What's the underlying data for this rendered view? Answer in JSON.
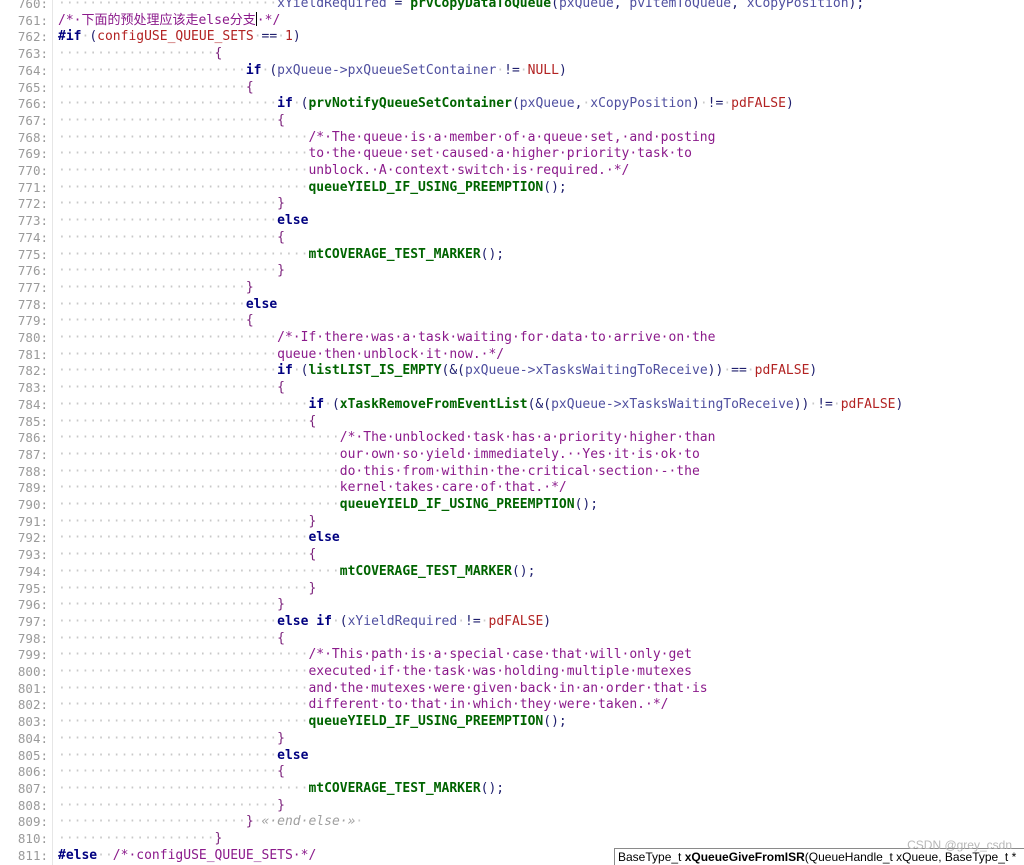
{
  "editor": {
    "lines": [
      {
        "num": "760:",
        "segs": [
          [
            "ws",
            "····························"
          ],
          [
            "var",
            "xYieldRequired"
          ],
          [
            "txt",
            " = "
          ],
          [
            "fn",
            "prvCopyDataToQueue"
          ],
          [
            "txt",
            "("
          ],
          [
            "var",
            "pxQueue"
          ],
          [
            "txt",
            ", "
          ],
          [
            "var",
            "pvItemToQueue"
          ],
          [
            "txt",
            ", "
          ],
          [
            "var",
            "xCopyPosition"
          ],
          [
            "txt",
            ");"
          ]
        ]
      },
      {
        "num": "761:",
        "segs": [
          [
            "cm",
            "/*·下面的预处理应该走else分支"
          ],
          [
            "caret",
            ""
          ],
          [
            "cm",
            "·*/"
          ]
        ]
      },
      {
        "num": "762:",
        "segs": [
          [
            "kw",
            "#if"
          ],
          [
            "ws",
            "·"
          ],
          [
            "txt",
            "("
          ],
          [
            "num",
            "configUSE_QUEUE_SETS"
          ],
          [
            "ws",
            "·"
          ],
          [
            "txt",
            "=="
          ],
          [
            "ws",
            "·"
          ],
          [
            "num",
            "1"
          ],
          [
            "txt",
            ")"
          ]
        ]
      },
      {
        "num": "763:",
        "segs": [
          [
            "ws",
            "····················"
          ],
          [
            "br",
            "{"
          ]
        ]
      },
      {
        "num": "764:",
        "segs": [
          [
            "ws",
            "························"
          ],
          [
            "kw",
            "if"
          ],
          [
            "ws",
            "·"
          ],
          [
            "txt",
            "("
          ],
          [
            "var",
            "pxQueue->pxQueueSetContainer"
          ],
          [
            "ws",
            "·"
          ],
          [
            "txt",
            "!="
          ],
          [
            "ws",
            "·"
          ],
          [
            "num",
            "NULL"
          ],
          [
            "txt",
            ")"
          ]
        ]
      },
      {
        "num": "765:",
        "segs": [
          [
            "ws",
            "························"
          ],
          [
            "br",
            "{"
          ]
        ]
      },
      {
        "num": "766:",
        "segs": [
          [
            "ws",
            "····························"
          ],
          [
            "kw",
            "if"
          ],
          [
            "ws",
            "·"
          ],
          [
            "txt",
            "("
          ],
          [
            "fn",
            "prvNotifyQueueSetContainer"
          ],
          [
            "txt",
            "("
          ],
          [
            "var",
            "pxQueue"
          ],
          [
            "txt",
            ","
          ],
          [
            "ws",
            "·"
          ],
          [
            "var",
            "xCopyPosition"
          ],
          [
            "txt",
            ")"
          ],
          [
            "ws",
            "·"
          ],
          [
            "txt",
            "!="
          ],
          [
            "ws",
            "·"
          ],
          [
            "num",
            "pdFALSE"
          ],
          [
            "txt",
            ")"
          ]
        ]
      },
      {
        "num": "767:",
        "segs": [
          [
            "ws",
            "····························"
          ],
          [
            "br",
            "{"
          ]
        ]
      },
      {
        "num": "768:",
        "segs": [
          [
            "ws",
            "································"
          ],
          [
            "cm",
            "/*·The·queue·is·a·member·of·a·queue·set,·and·posting"
          ]
        ]
      },
      {
        "num": "769:",
        "segs": [
          [
            "ws",
            "································"
          ],
          [
            "cm",
            "to·the·queue·set·caused·a·higher·priority·task·to"
          ]
        ]
      },
      {
        "num": "770:",
        "segs": [
          [
            "ws",
            "································"
          ],
          [
            "cm",
            "unblock.·A·context·switch·is·required.·*/"
          ]
        ]
      },
      {
        "num": "771:",
        "segs": [
          [
            "ws",
            "································"
          ],
          [
            "fn",
            "queueYIELD_IF_USING_PREEMPTION"
          ],
          [
            "txt",
            "();"
          ]
        ]
      },
      {
        "num": "772:",
        "segs": [
          [
            "ws",
            "····························"
          ],
          [
            "br",
            "}"
          ]
        ]
      },
      {
        "num": "773:",
        "segs": [
          [
            "ws",
            "····························"
          ],
          [
            "kw",
            "else"
          ]
        ]
      },
      {
        "num": "774:",
        "segs": [
          [
            "ws",
            "····························"
          ],
          [
            "br",
            "{"
          ]
        ]
      },
      {
        "num": "775:",
        "segs": [
          [
            "ws",
            "································"
          ],
          [
            "fn",
            "mtCOVERAGE_TEST_MARKER"
          ],
          [
            "txt",
            "();"
          ]
        ]
      },
      {
        "num": "776:",
        "segs": [
          [
            "ws",
            "····························"
          ],
          [
            "br",
            "}"
          ]
        ]
      },
      {
        "num": "777:",
        "segs": [
          [
            "ws",
            "························"
          ],
          [
            "br",
            "}"
          ]
        ]
      },
      {
        "num": "778:",
        "segs": [
          [
            "ws",
            "························"
          ],
          [
            "kw",
            "else"
          ]
        ]
      },
      {
        "num": "779:",
        "segs": [
          [
            "ws",
            "························"
          ],
          [
            "br",
            "{"
          ]
        ]
      },
      {
        "num": "780:",
        "segs": [
          [
            "ws",
            "····························"
          ],
          [
            "cm",
            "/*·If·there·was·a·task·waiting·for·data·to·arrive·on·the"
          ]
        ]
      },
      {
        "num": "781:",
        "segs": [
          [
            "ws",
            "····························"
          ],
          [
            "cm",
            "queue·then·unblock·it·now.·*/"
          ]
        ]
      },
      {
        "num": "782:",
        "segs": [
          [
            "ws",
            "····························"
          ],
          [
            "kw",
            "if"
          ],
          [
            "ws",
            "·"
          ],
          [
            "txt",
            "("
          ],
          [
            "fn",
            "listLIST_IS_EMPTY"
          ],
          [
            "txt",
            "(&("
          ],
          [
            "var",
            "pxQueue->xTasksWaitingToReceive"
          ],
          [
            "txt",
            "))"
          ],
          [
            "ws",
            "·"
          ],
          [
            "txt",
            "=="
          ],
          [
            "ws",
            "·"
          ],
          [
            "num",
            "pdFALSE"
          ],
          [
            "txt",
            ")"
          ]
        ]
      },
      {
        "num": "783:",
        "segs": [
          [
            "ws",
            "····························"
          ],
          [
            "br",
            "{"
          ]
        ]
      },
      {
        "num": "784:",
        "segs": [
          [
            "ws",
            "································"
          ],
          [
            "kw",
            "if"
          ],
          [
            "ws",
            "·"
          ],
          [
            "txt",
            "("
          ],
          [
            "fn",
            "xTaskRemoveFromEventList"
          ],
          [
            "txt",
            "(&("
          ],
          [
            "var",
            "pxQueue->xTasksWaitingToReceive"
          ],
          [
            "txt",
            "))"
          ],
          [
            "ws",
            "·"
          ],
          [
            "txt",
            "!="
          ],
          [
            "ws",
            "·"
          ],
          [
            "num",
            "pdFALSE"
          ],
          [
            "txt",
            ")"
          ]
        ]
      },
      {
        "num": "785:",
        "segs": [
          [
            "ws",
            "································"
          ],
          [
            "br",
            "{"
          ]
        ]
      },
      {
        "num": "786:",
        "segs": [
          [
            "ws",
            "····································"
          ],
          [
            "cm",
            "/*·The·unblocked·task·has·a·priority·higher·than"
          ]
        ]
      },
      {
        "num": "787:",
        "segs": [
          [
            "ws",
            "····································"
          ],
          [
            "cm",
            "our·own·so·yield·immediately.··Yes·it·is·ok·to"
          ]
        ]
      },
      {
        "num": "788:",
        "segs": [
          [
            "ws",
            "····································"
          ],
          [
            "cm",
            "do·this·from·within·the·critical·section·-·the"
          ]
        ]
      },
      {
        "num": "789:",
        "segs": [
          [
            "ws",
            "····································"
          ],
          [
            "cm",
            "kernel·takes·care·of·that.·*/"
          ]
        ]
      },
      {
        "num": "790:",
        "segs": [
          [
            "ws",
            "····································"
          ],
          [
            "fn",
            "queueYIELD_IF_USING_PREEMPTION"
          ],
          [
            "txt",
            "();"
          ]
        ]
      },
      {
        "num": "791:",
        "segs": [
          [
            "ws",
            "································"
          ],
          [
            "br",
            "}"
          ]
        ]
      },
      {
        "num": "792:",
        "segs": [
          [
            "ws",
            "································"
          ],
          [
            "kw",
            "else"
          ]
        ]
      },
      {
        "num": "793:",
        "segs": [
          [
            "ws",
            "································"
          ],
          [
            "br",
            "{"
          ]
        ]
      },
      {
        "num": "794:",
        "segs": [
          [
            "ws",
            "····································"
          ],
          [
            "fn",
            "mtCOVERAGE_TEST_MARKER"
          ],
          [
            "txt",
            "();"
          ]
        ]
      },
      {
        "num": "795:",
        "segs": [
          [
            "ws",
            "································"
          ],
          [
            "br",
            "}"
          ]
        ]
      },
      {
        "num": "796:",
        "segs": [
          [
            "ws",
            "····························"
          ],
          [
            "br",
            "}"
          ]
        ]
      },
      {
        "num": "797:",
        "segs": [
          [
            "ws",
            "····························"
          ],
          [
            "kw",
            "else if"
          ],
          [
            "ws",
            "·"
          ],
          [
            "txt",
            "("
          ],
          [
            "var",
            "xYieldRequired"
          ],
          [
            "ws",
            "·"
          ],
          [
            "txt",
            "!="
          ],
          [
            "ws",
            "·"
          ],
          [
            "num",
            "pdFALSE"
          ],
          [
            "txt",
            ")"
          ]
        ]
      },
      {
        "num": "798:",
        "segs": [
          [
            "ws",
            "····························"
          ],
          [
            "br",
            "{"
          ]
        ]
      },
      {
        "num": "799:",
        "segs": [
          [
            "ws",
            "································"
          ],
          [
            "cm",
            "/*·This·path·is·a·special·case·that·will·only·get"
          ]
        ]
      },
      {
        "num": "800:",
        "segs": [
          [
            "ws",
            "································"
          ],
          [
            "cm",
            "executed·if·the·task·was·holding·multiple·mutexes"
          ]
        ]
      },
      {
        "num": "801:",
        "segs": [
          [
            "ws",
            "································"
          ],
          [
            "cm",
            "and·the·mutexes·were·given·back·in·an·order·that·is"
          ]
        ]
      },
      {
        "num": "802:",
        "segs": [
          [
            "ws",
            "································"
          ],
          [
            "cm",
            "different·to·that·in·which·they·were·taken.·*/"
          ]
        ]
      },
      {
        "num": "803:",
        "segs": [
          [
            "ws",
            "································"
          ],
          [
            "fn",
            "queueYIELD_IF_USING_PREEMPTION"
          ],
          [
            "txt",
            "();"
          ]
        ]
      },
      {
        "num": "804:",
        "segs": [
          [
            "ws",
            "····························"
          ],
          [
            "br",
            "}"
          ]
        ]
      },
      {
        "num": "805:",
        "segs": [
          [
            "ws",
            "····························"
          ],
          [
            "kw",
            "else"
          ]
        ]
      },
      {
        "num": "806:",
        "segs": [
          [
            "ws",
            "····························"
          ],
          [
            "br",
            "{"
          ]
        ]
      },
      {
        "num": "807:",
        "segs": [
          [
            "ws",
            "································"
          ],
          [
            "fn",
            "mtCOVERAGE_TEST_MARKER"
          ],
          [
            "txt",
            "();"
          ]
        ]
      },
      {
        "num": "808:",
        "segs": [
          [
            "ws",
            "····························"
          ],
          [
            "br",
            "}"
          ]
        ]
      },
      {
        "num": "809:",
        "segs": [
          [
            "ws",
            "························"
          ],
          [
            "br",
            "}"
          ],
          [
            "ws",
            "·"
          ],
          [
            "fold",
            "«·end·else·»"
          ],
          [
            "ws",
            "·"
          ]
        ]
      },
      {
        "num": "810:",
        "segs": [
          [
            "ws",
            "····················"
          ],
          [
            "br",
            "}"
          ]
        ]
      },
      {
        "num": "811:",
        "segs": [
          [
            "kw",
            "#else"
          ],
          [
            "ws",
            "··"
          ],
          [
            "cm",
            "/*·configUSE_QUEUE_SETS·*/"
          ]
        ]
      }
    ]
  },
  "tooltip": {
    "ret_type": "BaseType_t ",
    "func_name": "xQueueGiveFromISR",
    "params": "(QueueHandle_t xQueue, BaseType_t *"
  },
  "watermark": "CSDN @grey_csdn"
}
